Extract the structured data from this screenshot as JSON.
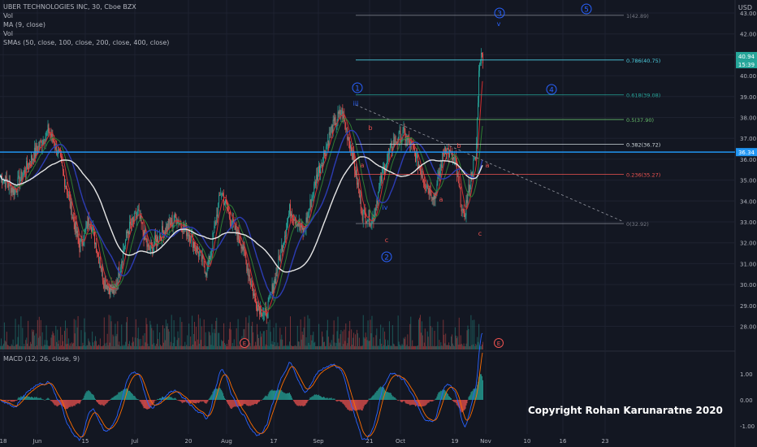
{
  "legend": {
    "title": "UBER TECHNOLOGIES INC, 30, Cboe BZX",
    "vol1": "Vol",
    "ma": "MA (9, close)",
    "vol2": "Vol",
    "smas": "SMAs (50, close, 100, close, 200, close, 400, close)"
  },
  "currency": "USD",
  "macd_label": "MACD (12, 26, close, 9)",
  "copyright": "Copyright Rohan Karunaratne 2020",
  "colors": {
    "background": "#131722",
    "grid": "#1e2230",
    "up": "#26a69a",
    "down": "#ef5350",
    "sma_white": "#e6e6e6",
    "sma_blue": "#2c3cb4",
    "ma_red": "#d32f2f",
    "ma_green": "#2e7d32",
    "horizontal_line": "#2196f3",
    "elliott_blue": "#2962ff",
    "price_label_bg": "#2196f3"
  },
  "chart_data": {
    "type": "candlestick",
    "title": "UBER TECHNOLOGIES INC, 30, Cboe BZX",
    "ylim": [
      27.2,
      43.3
    ],
    "y_ticks": [
      "43.00",
      "42.00",
      "41.00",
      "40.00",
      "39.00",
      "38.00",
      "37.00",
      "36.00",
      "35.00",
      "34.00",
      "33.00",
      "32.00",
      "31.00",
      "30.00",
      "29.00",
      "28.00"
    ],
    "x_ticks": [
      "18",
      "Jun",
      "15",
      "Jul",
      "20",
      "Aug",
      "17",
      "Sep",
      "21",
      "Oct",
      "19",
      "Nov",
      "10",
      "16",
      "23"
    ],
    "price_path": [
      {
        "t": 0,
        "p": 35.2
      },
      {
        "t": 0.02,
        "p": 34.5
      },
      {
        "t": 0.045,
        "p": 36.0
      },
      {
        "t": 0.07,
        "p": 37.4
      },
      {
        "t": 0.085,
        "p": 36.2
      },
      {
        "t": 0.1,
        "p": 34.0
      },
      {
        "t": 0.115,
        "p": 31.8
      },
      {
        "t": 0.13,
        "p": 33.2
      },
      {
        "t": 0.15,
        "p": 30.2
      },
      {
        "t": 0.165,
        "p": 29.6
      },
      {
        "t": 0.185,
        "p": 32.6
      },
      {
        "t": 0.2,
        "p": 33.4
      },
      {
        "t": 0.215,
        "p": 31.6
      },
      {
        "t": 0.235,
        "p": 32.5
      },
      {
        "t": 0.255,
        "p": 33.2
      },
      {
        "t": 0.275,
        "p": 32.4
      },
      {
        "t": 0.3,
        "p": 30.6
      },
      {
        "t": 0.32,
        "p": 34.5
      },
      {
        "t": 0.335,
        "p": 33.0
      },
      {
        "t": 0.35,
        "p": 32.0
      },
      {
        "t": 0.37,
        "p": 29.2
      },
      {
        "t": 0.385,
        "p": 28.5
      },
      {
        "t": 0.4,
        "p": 30.5
      },
      {
        "t": 0.42,
        "p": 33.6
      },
      {
        "t": 0.44,
        "p": 32.5
      },
      {
        "t": 0.46,
        "p": 35.3
      },
      {
        "t": 0.48,
        "p": 37.4
      },
      {
        "t": 0.495,
        "p": 38.3
      },
      {
        "t": 0.51,
        "p": 36.4
      },
      {
        "t": 0.525,
        "p": 33.4
      },
      {
        "t": 0.54,
        "p": 33.1
      },
      {
        "t": 0.555,
        "p": 35.4
      },
      {
        "t": 0.57,
        "p": 36.8
      },
      {
        "t": 0.585,
        "p": 37.2
      },
      {
        "t": 0.6,
        "p": 36.4
      },
      {
        "t": 0.615,
        "p": 35.0
      },
      {
        "t": 0.63,
        "p": 34.2
      },
      {
        "t": 0.645,
        "p": 36.6
      },
      {
        "t": 0.66,
        "p": 35.8
      },
      {
        "t": 0.672,
        "p": 33.1
      },
      {
        "t": 0.685,
        "p": 35.6
      },
      {
        "t": 0.69,
        "p": 36.0
      },
      {
        "t": 0.695,
        "p": 40.8
      },
      {
        "t": 0.7,
        "p": 40.94
      }
    ],
    "fibonacci": [
      {
        "level": "1(42.89)",
        "value": 42.89,
        "color": "#787b86"
      },
      {
        "level": "0.786(40.75)",
        "value": 40.75,
        "color": "#4dd0e1"
      },
      {
        "level": "0.618(39.08)",
        "value": 39.08,
        "color": "#26a69a"
      },
      {
        "level": "0.5(37.90)",
        "value": 37.9,
        "color": "#66bb6a"
      },
      {
        "level": "0.382(36.72)",
        "value": 36.72,
        "color": "#cfd8dc"
      },
      {
        "level": "0.236(35.27)",
        "value": 35.27,
        "color": "#ef5350"
      },
      {
        "level": "0(32.92)",
        "value": 32.92,
        "color": "#787b86"
      }
    ],
    "horizontal_line": 36.34,
    "price_labels": [
      {
        "text": "40.94",
        "value": 40.94,
        "bg": "#26a69a"
      },
      {
        "text": "15:39",
        "value": 40.55,
        "bg": "#26a69a"
      },
      {
        "text": "36.34",
        "value": 36.34,
        "bg": "#2196f3"
      }
    ],
    "elliott_labels": [
      {
        "text": "1",
        "circled": true
      },
      {
        "text": "2",
        "circled": true
      },
      {
        "text": "3",
        "circled": true
      },
      {
        "text": "4",
        "circled": true
      },
      {
        "text": "5",
        "circled": true
      },
      {
        "text": "iii",
        "circled": false
      },
      {
        "text": "iv",
        "circled": false
      },
      {
        "text": "v",
        "circled": false
      },
      {
        "text": "a",
        "circled": false
      },
      {
        "text": "b",
        "circled": false
      },
      {
        "text": "c",
        "circled": false
      }
    ],
    "earnings_markers": [
      "E",
      "E"
    ],
    "macd": {
      "label": "MACD (12, 26, close, 9)",
      "ylim": [
        -1.1,
        1.9
      ],
      "y_ticks": [
        "1.00",
        "0.00",
        "-1.00"
      ]
    }
  }
}
